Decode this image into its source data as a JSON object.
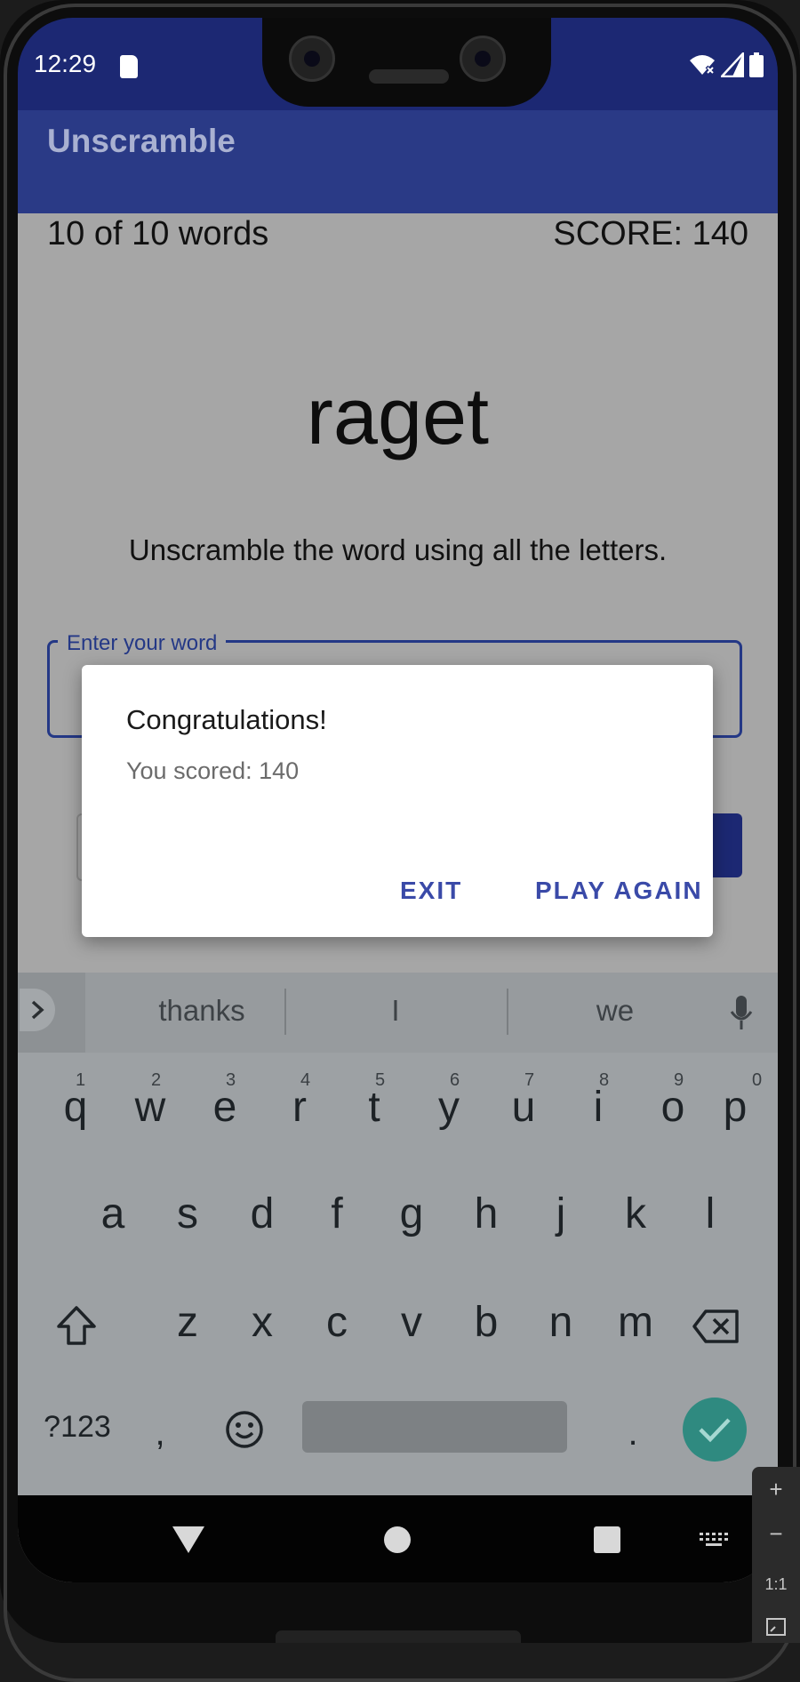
{
  "status_bar": {
    "time": "12:29"
  },
  "app_bar": {
    "title": "Unscramble"
  },
  "game": {
    "word_count": "10 of 10 words",
    "score": "SCORE: 140",
    "scrambled_word": "raget",
    "instructions": "Unscramble the word using all the letters.",
    "input_label": "Enter your word"
  },
  "dialog": {
    "title": "Congratulations!",
    "message": "You scored: 140",
    "exit_label": "EXIT",
    "play_again_label": "PLAY AGAIN"
  },
  "keyboard": {
    "suggestions": [
      "thanks",
      "I",
      "we"
    ],
    "row1": [
      "q",
      "w",
      "e",
      "r",
      "t",
      "y",
      "u",
      "i",
      "o",
      "p"
    ],
    "row1_hints": [
      "1",
      "2",
      "3",
      "4",
      "5",
      "6",
      "7",
      "8",
      "9",
      "0"
    ],
    "row2": [
      "a",
      "s",
      "d",
      "f",
      "g",
      "h",
      "j",
      "k",
      "l"
    ],
    "row3": [
      "z",
      "x",
      "c",
      "v",
      "b",
      "n",
      "m"
    ],
    "symbols_label": "?123",
    "comma": ",",
    "period": "."
  },
  "zoom_controls": {
    "zoom_in": "+",
    "zoom_out": "−",
    "one_to_one": "1:1"
  },
  "colors": {
    "primary": "#2a3a86",
    "status_bar": "#1c2873",
    "accent_button": "#3a4aa8",
    "enter_key": "#2f8a80"
  },
  "icons": [
    "sd-card-icon",
    "wifi-icon",
    "signal-icon",
    "battery-icon",
    "chevron-right-icon",
    "microphone-icon",
    "shift-icon",
    "backspace-icon",
    "emoji-icon",
    "check-icon",
    "nav-back-icon",
    "nav-home-icon",
    "nav-recents-icon",
    "keyboard-icon"
  ]
}
